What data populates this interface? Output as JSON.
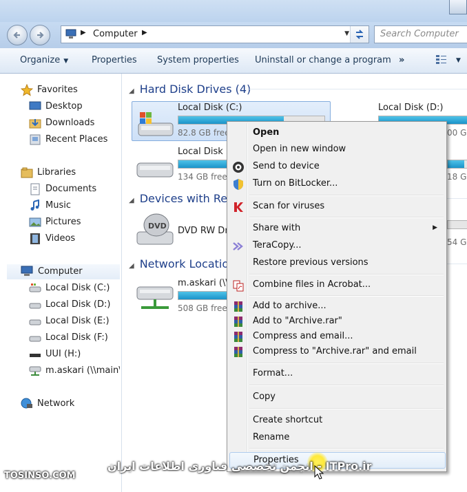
{
  "address": {
    "segments": [
      "Computer"
    ]
  },
  "search": {
    "placeholder": "Search Computer"
  },
  "toolbar": {
    "organize": "Organize",
    "properties": "Properties",
    "system_properties": "System properties",
    "uninstall": "Uninstall or change a program",
    "more": "»"
  },
  "sidebar": {
    "favorites": {
      "label": "Favorites",
      "items": [
        "Desktop",
        "Downloads",
        "Recent Places"
      ]
    },
    "libraries": {
      "label": "Libraries",
      "items": [
        "Documents",
        "Music",
        "Pictures",
        "Videos"
      ]
    },
    "computer": {
      "label": "Computer",
      "items": [
        "Local Disk (C:)",
        "Local Disk (D:)",
        "Local Disk (E:)",
        "Local Disk (F:)",
        "UUI (H:)",
        "m.askari (\\\\main\\"
      ]
    },
    "network": {
      "label": "Network"
    }
  },
  "content": {
    "groups": [
      {
        "title": "Hard Disk Drives (4)"
      },
      {
        "title": "Devices with Rem"
      },
      {
        "title": "Network Location"
      }
    ],
    "drives": [
      {
        "name": "Local Disk (C:)",
        "free": "82.8 GB free",
        "fill": 0.72
      },
      {
        "name": "Local Disk (D:)",
        "free": "00 GE",
        "fill": 0.85
      },
      {
        "name": "Local Disk (",
        "free": "134 GB free",
        "fill": 0.6
      },
      {
        "name": "",
        "free": "18 GE",
        "fill": 0.4
      },
      {
        "name": "DVD RW Dr",
        "free": ""
      },
      {
        "name": "",
        "free": "54 GI"
      },
      {
        "name": "m.askari (\\\\",
        "free": "508 GB free",
        "fill": 0.55
      }
    ]
  },
  "menu": {
    "items": [
      {
        "label": "Open",
        "bold": true
      },
      {
        "label": "Open in new window"
      },
      {
        "label": "Send to device",
        "icon": "device-icon"
      },
      {
        "label": "Turn on BitLocker...",
        "icon": "shield-icon"
      },
      {
        "label": "Scan for viruses",
        "icon": "kaspersky-icon"
      },
      {
        "label": "Share with",
        "submenu": true
      },
      {
        "label": "TeraCopy...",
        "icon": "teracopy-icon"
      },
      {
        "label": "Restore previous versions"
      },
      {
        "label": "Combine files in Acrobat...",
        "icon": "acrobat-icon"
      },
      {
        "label": "Add to archive...",
        "icon": "winrar-icon"
      },
      {
        "label": "Add to \"Archive.rar\"",
        "icon": "winrar-icon"
      },
      {
        "label": "Compress and email...",
        "icon": "winrar-icon"
      },
      {
        "label": "Compress to \"Archive.rar\" and email",
        "icon": "winrar-icon"
      },
      {
        "label": "Format..."
      },
      {
        "label": "Copy"
      },
      {
        "label": "Create shortcut"
      },
      {
        "label": "Rename"
      },
      {
        "label": "Properties"
      }
    ]
  },
  "watermark": {
    "left": "TOSINSO.COM",
    "center": "انجمن تخصصی فناوری اطلاعات ایران - ITPro.ir"
  },
  "colors": {
    "accent": "#1e3f8a",
    "drive_bar": "#1b93c9",
    "menu_bg": "#f0f0f0"
  }
}
